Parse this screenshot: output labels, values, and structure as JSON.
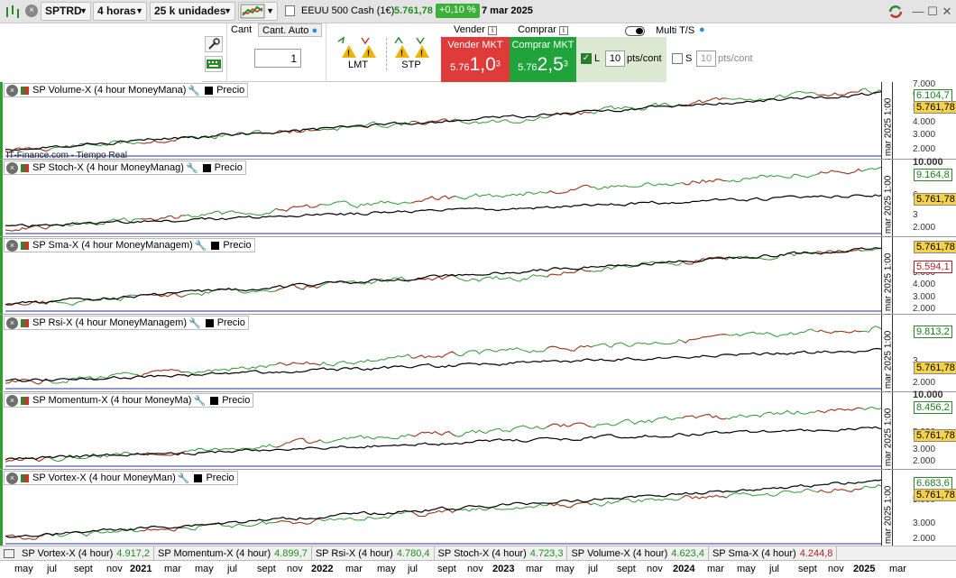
{
  "toolbar": {
    "symbol": "SPTRD",
    "timeframe": "4 horas",
    "units": "25 k unidades",
    "instrument_name": "EEUU 500 Cash (1€)",
    "price": "5.761,78",
    "change": "+0,10 %",
    "date": "7 mar 2025"
  },
  "order": {
    "cant_label": "Cant",
    "cant_auto_label": "Cant. Auto",
    "quantity": "1",
    "lmt_label": "LMT",
    "stp_label": "STP",
    "sell_header": "Vender",
    "buy_header": "Comprar",
    "sell_label": "Vender MKT",
    "sell_price_prefix": "5.76",
    "sell_price_main": "1,0",
    "sell_price_sup": "3",
    "buy_label": "Comprar MKT",
    "buy_price_prefix": "5.76",
    "buy_price_main": "2,5",
    "buy_price_sup": "3",
    "multi_ts_label": "Multi T/S",
    "l_label": "L",
    "l_pts": "10",
    "pts_cont": "pts/cont",
    "s_label": "S",
    "s_pts": "10"
  },
  "panels": [
    {
      "legend": "SP Volume-X (4 hour MoneyMana)",
      "price_label": "Precio",
      "ticks": [
        "7.000",
        "6.000",
        "5.000",
        "4.000",
        "3.000",
        "2.000"
      ],
      "value_label": "6.104,7",
      "value_color": "green",
      "price_value": "5.761,78",
      "date_tag": "3 mar 2025 1:00",
      "source": "IT-Finance.com - Tiempo Real"
    },
    {
      "legend": "SP Stoch-X (4 hour MoneyManag)",
      "price_label": "Precio",
      "ticks": [
        "10.000",
        "6",
        "3",
        "2.000"
      ],
      "value_label": "9.164,8",
      "value_color": "green",
      "price_value": "5.761,78",
      "date_tag": "3 mar 2025 1:00"
    },
    {
      "legend": "SP Sma-X (4 hour MoneyManagem)",
      "price_label": "Precio",
      "ticks": [
        "5.000",
        "4.000",
        "3.000",
        "2.000"
      ],
      "value_label": "5.594,1",
      "value_color": "red",
      "price_value": "5.761,78",
      "date_tag": "3 mar 2025 1:00"
    },
    {
      "legend": "SP Rsi-X (4 hour MoneyManagem)",
      "price_label": "Precio",
      "ticks": [
        "7",
        "3",
        "2.000"
      ],
      "value_label": "9.813,2",
      "value_color": "green",
      "price_value": "5.761,78",
      "date_tag": "3 mar 2025 1:00"
    },
    {
      "legend": "SP Momentum-X (4 hour MoneyMa)",
      "price_label": "Precio",
      "ticks": [
        "10.000",
        "5.000",
        "3.000",
        "2.000"
      ],
      "value_label": "8.456,2",
      "value_color": "green",
      "price_value": "5.761,78",
      "date_tag": "3 mar 2025 1:00"
    },
    {
      "legend": "SP  Vortex-X (4 hour MoneyMan)",
      "price_label": "Precio",
      "ticks": [
        "5.000",
        "3.000",
        "2.000"
      ],
      "value_label": "6.683,6",
      "value_color": "green",
      "price_value": "5.761,78",
      "date_tag": "3 mar 2025 1:00"
    }
  ],
  "bottom_legend": [
    {
      "name": "SP  Vortex-X (4 hour)",
      "value": "4.917,2",
      "color": "green"
    },
    {
      "name": "SP Momentum-X (4 hour)",
      "value": "4.899,7",
      "color": "green"
    },
    {
      "name": "SP Rsi-X (4 hour)",
      "value": "4.780,4",
      "color": "green"
    },
    {
      "name": "SP Stoch-X (4 hour)",
      "value": "4.723,3",
      "color": "green"
    },
    {
      "name": "SP Volume-X (4 hour)",
      "value": "4.623,4",
      "color": "green"
    },
    {
      "name": "SP Sma-X (4 hour)",
      "value": "4.244,8",
      "color": "red"
    }
  ],
  "x_axis": [
    "may",
    "jul",
    "sept",
    "nov",
    "2021",
    "mar",
    "may",
    "jul",
    "sept",
    "nov",
    "2022",
    "mar",
    "may",
    "jul",
    "sept",
    "nov",
    "2023",
    "mar",
    "may",
    "jul",
    "sept",
    "nov",
    "2024",
    "mar",
    "may",
    "jul",
    "sept",
    "nov",
    "2025",
    "mar"
  ],
  "colors": {
    "accent_green": "#2fa02f",
    "sell_red": "#e03b3b",
    "buy_green": "#1fa33a",
    "price_yellow": "#f5d24a"
  }
}
